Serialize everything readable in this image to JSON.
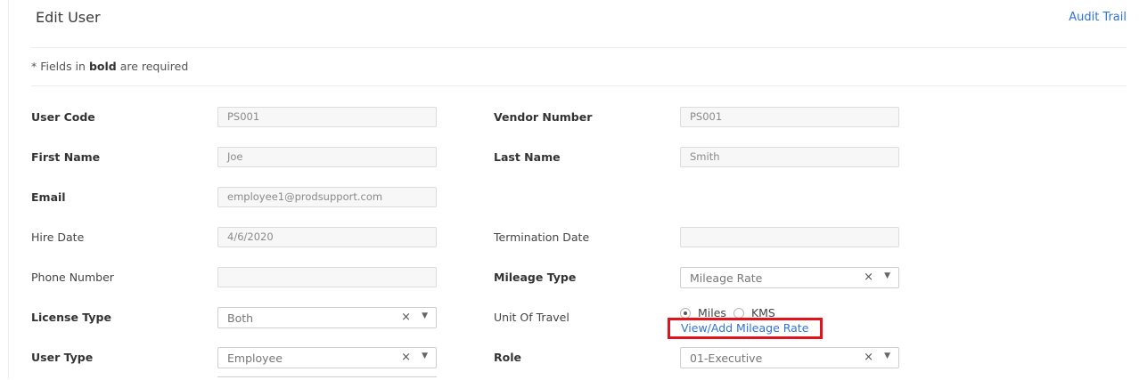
{
  "header": {
    "title": "Edit User",
    "audit_trail": "Audit Trail"
  },
  "note": {
    "prefix": "* Fields in ",
    "bold": "bold",
    "suffix": " are required"
  },
  "form": {
    "user_code": {
      "label": "User Code",
      "value": "PS001"
    },
    "vendor_number": {
      "label": "Vendor Number",
      "value": "PS001"
    },
    "first_name": {
      "label": "First Name",
      "value": "Joe"
    },
    "last_name": {
      "label": "Last Name",
      "value": "Smith"
    },
    "email": {
      "label": "Email",
      "value": "employee1@prodsupport.com"
    },
    "hire_date": {
      "label": "Hire Date",
      "value": "4/6/2020"
    },
    "termination_date": {
      "label": "Termination Date",
      "value": ""
    },
    "phone_number": {
      "label": "Phone Number",
      "value": ""
    },
    "mileage_type": {
      "label": "Mileage Type",
      "value": "Mileage Rate"
    },
    "license_type": {
      "label": "License Type",
      "value": "Both"
    },
    "unit_of_travel": {
      "label": "Unit Of Travel",
      "options": [
        "Miles",
        "KMS"
      ],
      "selected": "Miles"
    },
    "mileage_rate_link": "View/Add Mileage Rate",
    "user_type": {
      "label": "User Type",
      "value": "Employee"
    },
    "role": {
      "label": "Role",
      "value": "01-Executive"
    }
  },
  "icons": {
    "clear": "×",
    "dropdown": "chevron-down"
  },
  "colors": {
    "link": "#2f73d9",
    "highlight": "#e3131c"
  }
}
